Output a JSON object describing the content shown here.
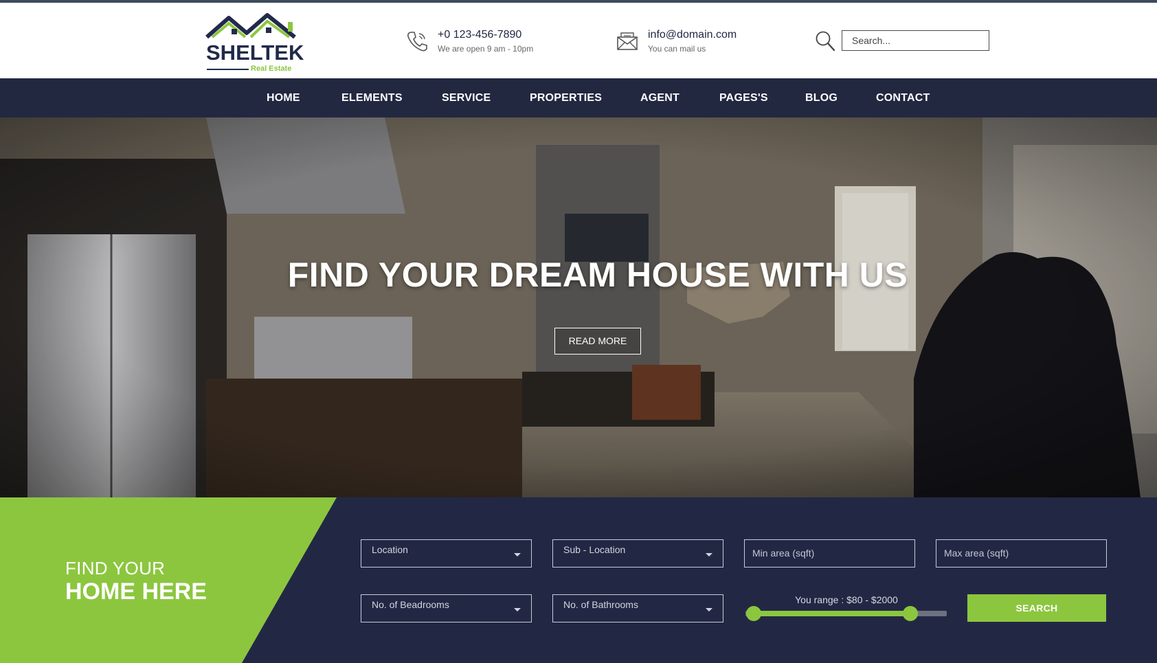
{
  "brand": {
    "name": "SHELTEK",
    "tagline": "Real Estate",
    "accent_color": "#8cc63f",
    "navy_color": "#232841"
  },
  "header": {
    "phone": {
      "icon": "phone-icon",
      "main": "+0 123-456-7890",
      "sub": "We are open 9 am - 10pm"
    },
    "email": {
      "icon": "envelope-icon",
      "main": "info@domain.com",
      "sub": "You can mail us"
    },
    "search": {
      "icon": "search-icon",
      "placeholder": "Search..."
    }
  },
  "nav": {
    "items": [
      "HOME",
      "ELEMENTS",
      "SERVICE",
      "PROPERTIES",
      "AGENT",
      "PAGES'S",
      "BLOG",
      "CONTACT"
    ]
  },
  "hero": {
    "title": "FIND YOUR DREAM HOUSE WITH US",
    "button": "READ MORE"
  },
  "finder": {
    "title_line1": "FIND YOUR",
    "title_line2": "HOME HERE",
    "location": "Location",
    "sub_location": "Sub - Location",
    "min_area": "Min area (sqft)",
    "max_area": "Max area (sqft)",
    "bedrooms": "No. of Beadrooms",
    "bathrooms": "No. of Bathrooms",
    "range_label": "You range : $80 - $2000",
    "range_min_fraction": 0.04,
    "range_max_fraction": 0.82,
    "search_button": "SEARCH"
  }
}
